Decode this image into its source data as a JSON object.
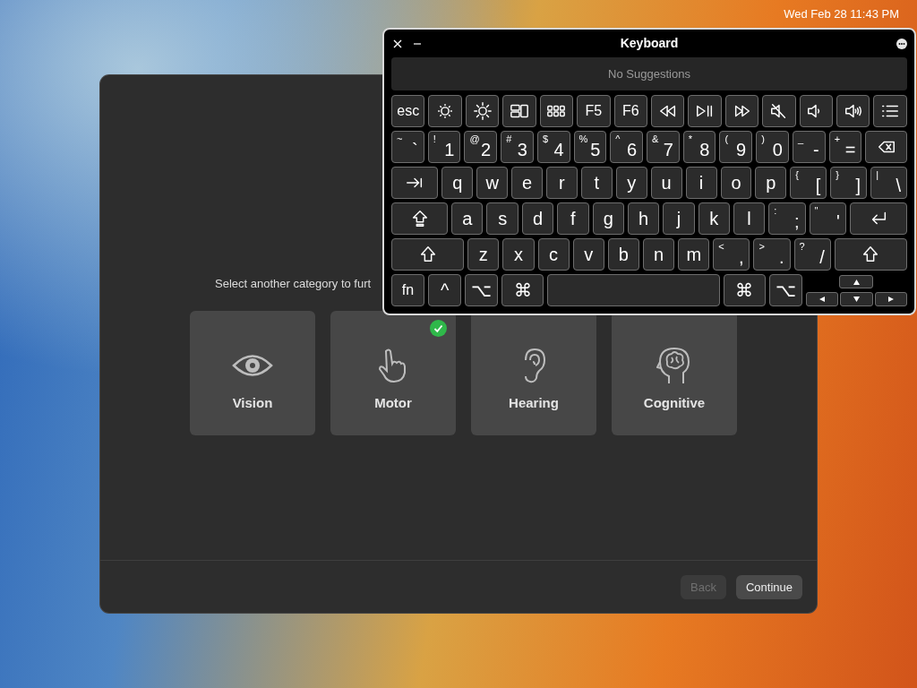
{
  "menu_bar": {
    "clock": "Wed Feb 28 11:43 PM"
  },
  "dialog": {
    "prompt": "Select another category to furt",
    "categories": [
      {
        "label": "Vision",
        "selected": false
      },
      {
        "label": "Motor",
        "selected": true
      },
      {
        "label": "Hearing",
        "selected": false
      },
      {
        "label": "Cognitive",
        "selected": false
      }
    ],
    "buttons": [
      {
        "label": "Back",
        "disabled": true
      },
      {
        "label": "Continue",
        "disabled": false
      }
    ]
  },
  "keyboard": {
    "title": "Keyboard",
    "suggestions": "No Suggestions",
    "rows": [
      {
        "keys": [
          {
            "kind": "word",
            "label": "esc"
          },
          {
            "kind": "dim"
          },
          {
            "kind": "bright"
          },
          {
            "kind": "mission"
          },
          {
            "kind": "launchpad"
          },
          {
            "kind": "word",
            "label": "F5"
          },
          {
            "kind": "word",
            "label": "F6"
          },
          {
            "kind": "rewind"
          },
          {
            "kind": "play"
          },
          {
            "kind": "forward"
          },
          {
            "kind": "mute"
          },
          {
            "kind": "voldown"
          },
          {
            "kind": "volup"
          },
          {
            "kind": "list"
          }
        ]
      },
      {
        "keys": [
          {
            "kind": "char",
            "label": "`",
            "shift": "~"
          },
          {
            "kind": "char",
            "label": "1",
            "shift": "!"
          },
          {
            "kind": "char",
            "label": "2",
            "shift": "@"
          },
          {
            "kind": "char",
            "label": "3",
            "shift": "#"
          },
          {
            "kind": "char",
            "label": "4",
            "shift": "$"
          },
          {
            "kind": "char",
            "label": "5",
            "shift": "%"
          },
          {
            "kind": "char",
            "label": "6",
            "shift": "^"
          },
          {
            "kind": "char",
            "label": "7",
            "shift": "&"
          },
          {
            "kind": "char",
            "label": "8",
            "shift": "*"
          },
          {
            "kind": "char",
            "label": "9",
            "shift": "("
          },
          {
            "kind": "char",
            "label": "0",
            "shift": ")"
          },
          {
            "kind": "char",
            "label": "-",
            "shift": "_"
          },
          {
            "kind": "char",
            "label": "=",
            "shift": "+"
          },
          {
            "kind": "delete"
          }
        ]
      },
      {
        "keys": [
          {
            "kind": "tab"
          },
          {
            "kind": "char",
            "label": "q"
          },
          {
            "kind": "char",
            "label": "w"
          },
          {
            "kind": "char",
            "label": "e"
          },
          {
            "kind": "char",
            "label": "r"
          },
          {
            "kind": "char",
            "label": "t"
          },
          {
            "kind": "char",
            "label": "y"
          },
          {
            "kind": "char",
            "label": "u"
          },
          {
            "kind": "char",
            "label": "i"
          },
          {
            "kind": "char",
            "label": "o"
          },
          {
            "kind": "char",
            "label": "p"
          },
          {
            "kind": "char",
            "label": "[",
            "shift": "{"
          },
          {
            "kind": "char",
            "label": "]",
            "shift": "}"
          },
          {
            "kind": "char",
            "label": "\\",
            "shift": "|"
          }
        ]
      },
      {
        "keys": [
          {
            "kind": "caps"
          },
          {
            "kind": "char",
            "label": "a"
          },
          {
            "kind": "char",
            "label": "s"
          },
          {
            "kind": "char",
            "label": "d"
          },
          {
            "kind": "char",
            "label": "f"
          },
          {
            "kind": "char",
            "label": "g"
          },
          {
            "kind": "char",
            "label": "h"
          },
          {
            "kind": "char",
            "label": "j"
          },
          {
            "kind": "char",
            "label": "k"
          },
          {
            "kind": "char",
            "label": "l"
          },
          {
            "kind": "char",
            "label": ";",
            "shift": ":"
          },
          {
            "kind": "char",
            "label": "'",
            "shift": "\""
          },
          {
            "kind": "return"
          }
        ]
      },
      {
        "keys": [
          {
            "kind": "shift"
          },
          {
            "kind": "char",
            "label": "z"
          },
          {
            "kind": "char",
            "label": "x"
          },
          {
            "kind": "char",
            "label": "c"
          },
          {
            "kind": "char",
            "label": "v"
          },
          {
            "kind": "char",
            "label": "b"
          },
          {
            "kind": "char",
            "label": "n"
          },
          {
            "kind": "char",
            "label": "m"
          },
          {
            "kind": "char",
            "label": ",",
            "shift": "<"
          },
          {
            "kind": "char",
            "label": ".",
            "shift": ">"
          },
          {
            "kind": "char",
            "label": "/",
            "shift": "?"
          },
          {
            "kind": "shift"
          }
        ]
      },
      {
        "keys": [
          {
            "kind": "word",
            "label": "fn"
          },
          {
            "kind": "char",
            "label": "^"
          },
          {
            "kind": "char",
            "label": "⌥"
          },
          {
            "kind": "command",
            "label": "⌘"
          },
          {
            "kind": "space"
          },
          {
            "kind": "command",
            "label": "⌘"
          },
          {
            "kind": "char",
            "label": "⌥"
          },
          {
            "kind": "arrows"
          }
        ]
      }
    ]
  }
}
